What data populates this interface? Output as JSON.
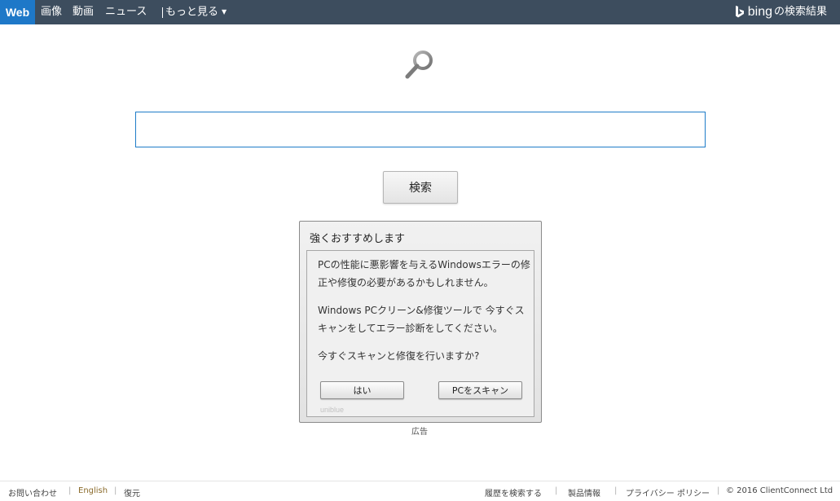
{
  "nav": {
    "web": "Web",
    "images": "画像",
    "videos": "動画",
    "news": "ニュース",
    "more": "もっと見る",
    "brand_word": "bing",
    "brand_suffix": "の検索結果"
  },
  "search": {
    "value": "",
    "button_label": "検索"
  },
  "dialog": {
    "title": "強くおすすめします",
    "paragraph1": "PCの性能に悪影響を与えるWindowsエラーの修正や修復の必要があるかもしれません。",
    "paragraph2": "Windows PCクリーン&修復ツールで 今すぐスキャンをしてエラー診断をしてください。",
    "question": "今すぐスキャンと修復を行いますか?",
    "yes_button": "はい",
    "scan_button": "PCをスキャン",
    "watermark": "uniblue"
  },
  "ad_label": "広告",
  "footer": {
    "contact": "お問い合わせ",
    "english": "English",
    "restore": "復元",
    "history": "履歴を検索する",
    "product_info": "製品情報",
    "privacy": "プライバシー ポリシー",
    "copyright": "© 2016 ClientConnect Ltd",
    "separator": "|"
  },
  "colors": {
    "topbar": "#3d4d5e",
    "web_tab": "#1e78c8",
    "search_border": "#1e7cc8"
  }
}
